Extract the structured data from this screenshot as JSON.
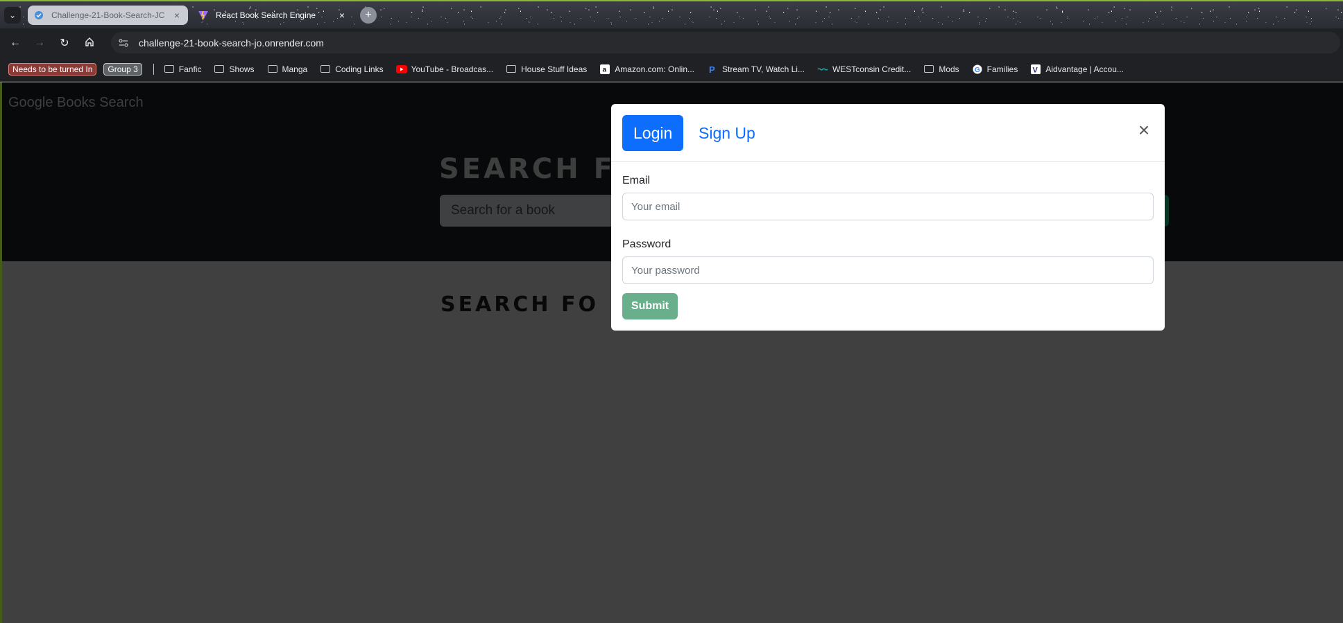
{
  "browser": {
    "tabs": [
      {
        "title": "Challenge-21-Book-Search-JC",
        "active": false
      },
      {
        "title": "React Book Search Engine",
        "active": true
      }
    ],
    "new_tab_symbol": "+",
    "url": "challenge-21-book-search-jo.onrender.com",
    "bookmarks": {
      "groups": [
        {
          "label": "Needs to be turned In",
          "color": "#8a3b37"
        },
        {
          "label": "Group 3",
          "color": "#5f6368"
        }
      ],
      "items": [
        {
          "label": "Fanfic",
          "icon": "folder-icon"
        },
        {
          "label": "Shows",
          "icon": "folder-icon"
        },
        {
          "label": "Manga",
          "icon": "folder-icon"
        },
        {
          "label": "Coding Links",
          "icon": "folder-icon"
        },
        {
          "label": "YouTube - Broadcas...",
          "icon": "youtube-icon"
        },
        {
          "label": "House Stuff Ideas",
          "icon": "folder-icon"
        },
        {
          "label": "Amazon.com: Onlin...",
          "icon": "amazon-icon"
        },
        {
          "label": "Stream TV, Watch Li...",
          "icon": "paramount-icon"
        },
        {
          "label": "WESTconsin Credit...",
          "icon": "credit-union-icon"
        },
        {
          "label": "Mods",
          "icon": "folder-icon"
        },
        {
          "label": "Families",
          "icon": "google-icon"
        },
        {
          "label": "Aidvantage | Accou...",
          "icon": "aidvantage-icon"
        }
      ]
    }
  },
  "app": {
    "brand": "Google Books Search",
    "hero_title": "SEARCH F",
    "search_placeholder": "Search for a book",
    "results_title": "SEARCH FO"
  },
  "modal": {
    "tabs": {
      "login": "Login",
      "signup": "Sign Up"
    },
    "active_tab": "login",
    "close_symbol": "×",
    "email_label": "Email",
    "email_placeholder": "Your email",
    "password_label": "Password",
    "password_placeholder": "Your password",
    "submit_label": "Submit"
  },
  "colors": {
    "primary": "#0d6efd",
    "submit_disabled": "#6aaf8c",
    "navbar": "#111314",
    "accent_border": "#8ab832"
  }
}
